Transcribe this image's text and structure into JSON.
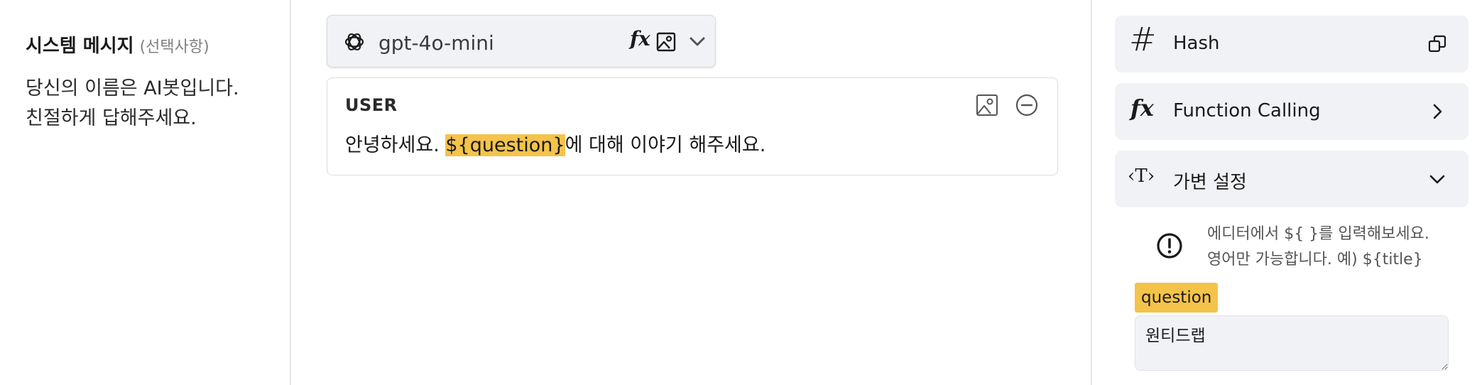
{
  "system": {
    "title": "시스템 메시지",
    "optional": "(선택사항)",
    "lines": [
      "당신의 이름은 AI봇입니다.",
      "친절하게 답해주세요."
    ]
  },
  "model": {
    "name": "gpt-4o-mini",
    "icons": [
      "openai-icon",
      "fx-icon",
      "image-icon",
      "chevron-down-icon"
    ]
  },
  "message": {
    "role": "USER",
    "text_before": "안녕하세요. ",
    "variable": "${question}",
    "text_after": "에 대해 이야기 해주세요."
  },
  "panels": {
    "hash": {
      "label": "Hash"
    },
    "function_calling": {
      "label": "Function Calling"
    },
    "variables": {
      "label": "가변 설정"
    }
  },
  "hint": {
    "line1": "에디터에서 ${ }를 입력해보세요.",
    "line2": "영어만 가능합니다. 예) ${title}"
  },
  "variable": {
    "name": "question",
    "value": "원티드랩"
  },
  "colors": {
    "highlight": "#f4c34a",
    "panel_bg": "#f1f2f5",
    "divider": "#e6e6e6"
  }
}
